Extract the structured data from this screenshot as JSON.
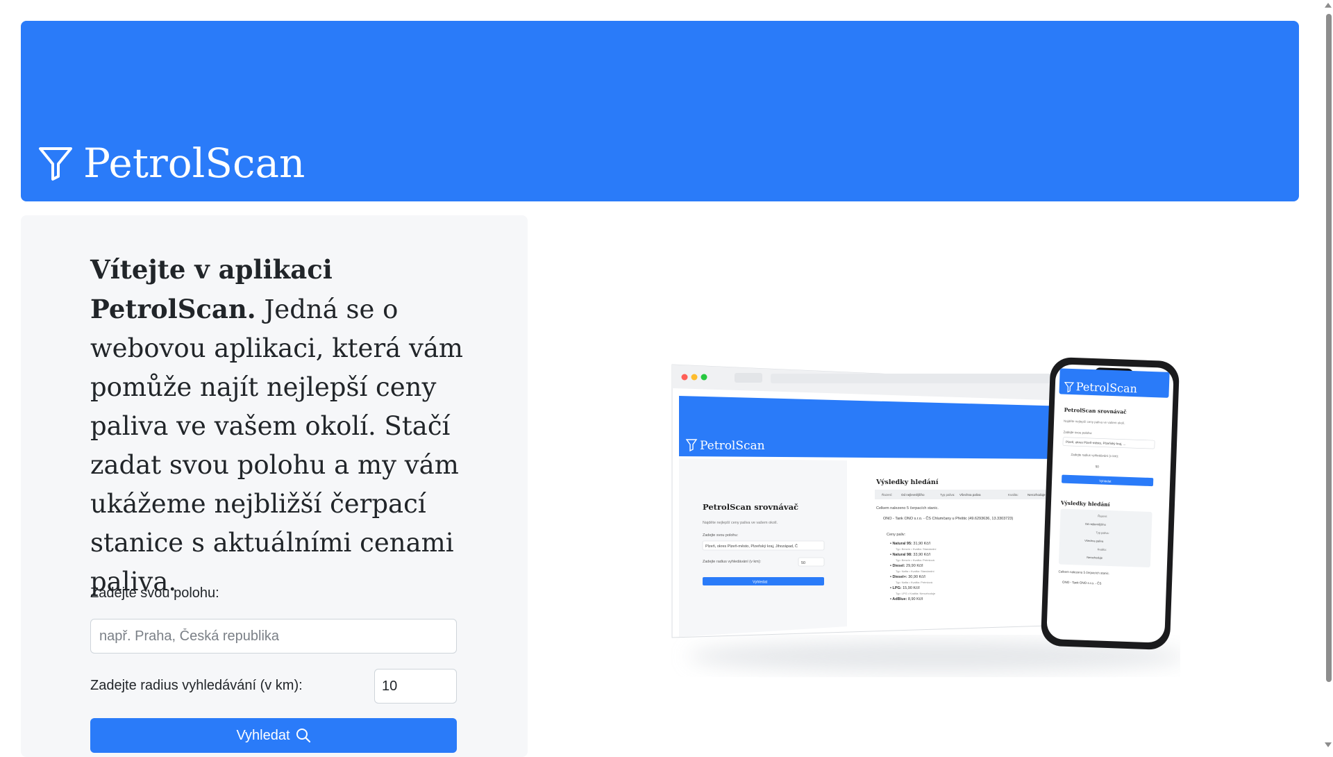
{
  "header": {
    "brand_title": "PetrolScan",
    "icon": "filter-icon",
    "color": "#2a7bf9"
  },
  "intro": {
    "bold": "Vítejte v aplikaci PetrolScan.",
    "text": "Jedná se o webovou aplikaci, která vám pomůže najít nejlepší ceny paliva ve vašem okolí. Stačí zadat svou polohu a my vám ukážeme nejbližší čerpací stanice s aktuálními cenami paliva."
  },
  "form": {
    "location_label": "Zadejte svou polohu:",
    "location_placeholder": "např. Praha, Česká republika",
    "location_value": "",
    "radius_label": "Zadejte radius vyhledávání (v km):",
    "radius_value": "10",
    "search_label": "Vyhledat",
    "search_icon": "search-icon"
  },
  "mockup": {
    "desktop": {
      "brand_title": "PetrolScan",
      "form_title": "PetrolScan srovnávač",
      "form_sub": "Najděte nejlepší ceny paliva ve vašem okolí.",
      "location_label": "Zadejte svou polohu:",
      "location_value": "Plzeň, okres Plzeň-město, Plzeňský kraj, Jihozápad, Č",
      "radius_label": "Zadejte radius vyhledávání (v km):",
      "radius_value": "50",
      "search_label": "Vyhledat",
      "results_title": "Výsledky hledání",
      "filter_sort_label": "Řazení:",
      "filter_sort_value": "Od nejlevnějšího",
      "filter_fuel_label": "Typ paliva:",
      "filter_fuel_value": "Všechna paliva",
      "filter_quality_label": "Kvalita:",
      "filter_quality_value": "Nerozhoduje",
      "results_count": "Celkem nalezeno 5 čerpacích stanic.",
      "station": "ONO - Tank ONO s.r.o. - ČS Chlumčany u Přeštic (49.6293636, 13.3303723)",
      "prices_label": "Ceny paliv:",
      "prices": [
        {
          "name": "Natural 95",
          "price": "31,90 Kč/l",
          "detail": "Typ: Benzín  •  Kvalita: Standardní"
        },
        {
          "name": "Natural 98",
          "price": "33,90 Kč/l",
          "detail": "Typ: Benzín  •  Kvalita: Prémiová"
        },
        {
          "name": "Diesel",
          "price": "29,90 Kč/l",
          "detail": "Typ: Nafta  •  Kvalita: Standardní"
        },
        {
          "name": "Diesel+",
          "price": "30,90 Kč/l",
          "detail": "Typ: Nafta  •  Kvalita: Prémiová"
        },
        {
          "name": "LPG",
          "price": "15,90 Kč/l",
          "detail": "Typ: LPG  •  Kvalita: Nerozhoduje"
        },
        {
          "name": "AdBlue",
          "price": "8,90 Kč/l",
          "detail": ""
        }
      ]
    },
    "phone": {
      "brand_title": "PetrolScan",
      "form_title": "PetrolScan srovnávač",
      "form_sub": "Najděte nejlepší ceny paliva ve vašem okolí.",
      "location_label": "Zadejte svou polohu:",
      "location_value": "Plzeň, okres Plzeň-město, Plzeňský kraj, ...",
      "radius_label": "Zadejte radius vyhledávání (v km):",
      "radius_value": "50",
      "search_label": "Vyhledat",
      "results_title": "Výsledky hledání",
      "sort_label": "Řazení:",
      "sort_value": "Od nejlevnějšího",
      "fuel_label": "Typ paliva:",
      "fuel_value": "Všechna paliva",
      "quality_label": "Kvalita:",
      "quality_value": "Nerozhoduje",
      "results_count": "Celkem nalezeno 5 čerpacích stanic.",
      "station": "ONO - Tank ONO s.r.o. - ČS"
    }
  }
}
